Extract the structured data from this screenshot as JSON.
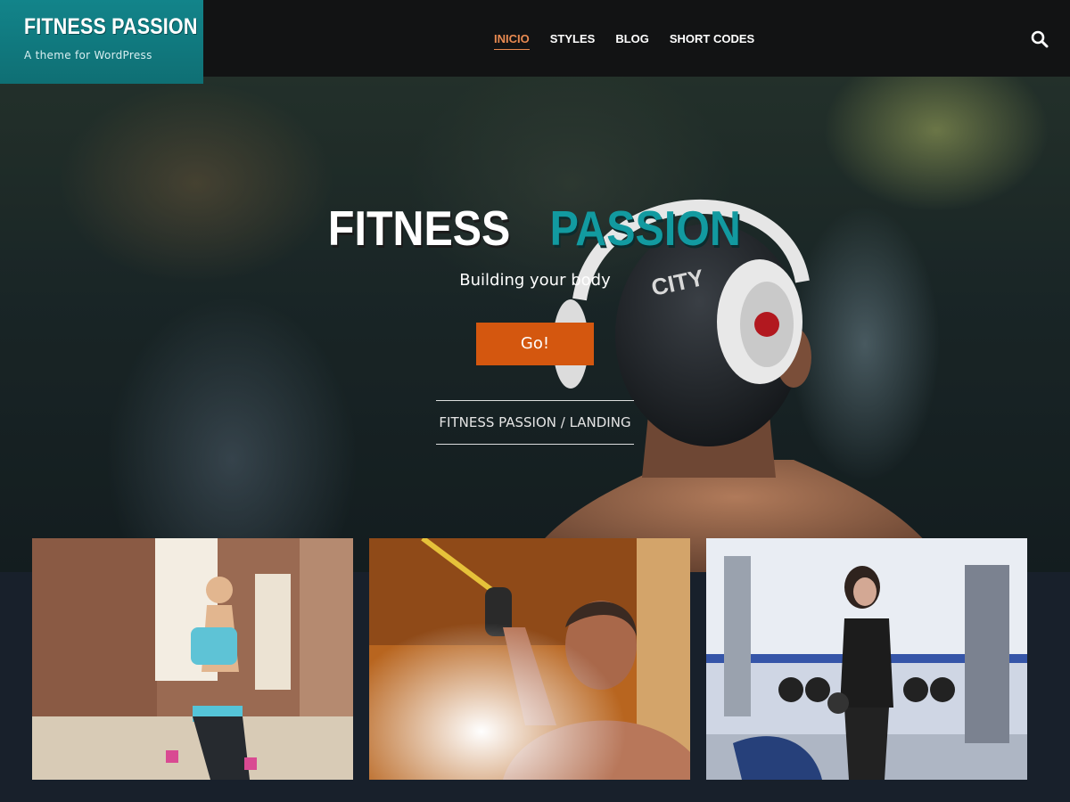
{
  "site": {
    "title": "FITNESS PASSION",
    "tagline": "A theme for WordPress"
  },
  "nav": {
    "items": [
      {
        "label": "INICIO",
        "active": true
      },
      {
        "label": "STYLES",
        "active": false
      },
      {
        "label": "BLOG",
        "active": false
      },
      {
        "label": "SHORT CODES",
        "active": false
      }
    ],
    "search_icon": "search-icon"
  },
  "hero": {
    "title_part1": "FITNESS",
    "title_part2": "PASSION",
    "subtitle": "Building your body",
    "button_label": "Go!",
    "breadcrumb": "FITNESS PASSION / LANDING"
  },
  "colors": {
    "brand_teal": "#12848a",
    "accent_orange": "#d4570f",
    "nav_active": "#e98a51",
    "header_bg": "#121314",
    "page_bg": "#18202b"
  },
  "cards": [
    {
      "image": "woman-with-dumbbells-photo"
    },
    {
      "image": "man-training-with-rope-photo"
    },
    {
      "image": "woman-in-gym-photo"
    }
  ]
}
